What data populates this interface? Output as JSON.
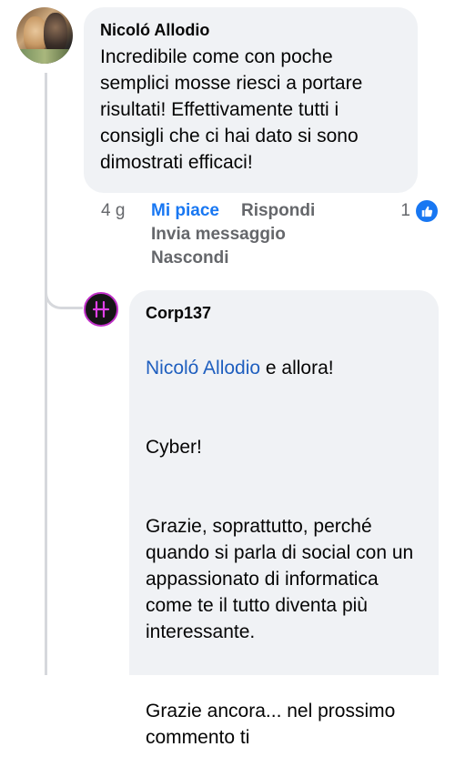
{
  "comment": {
    "author": "Nicoló Allodio",
    "text": "Incredibile come con poche semplici mosse riesci a portare risultati! Effettivamente tutti i consigli che ci hai dato si sono dimostrati efficaci!",
    "time": "4 g",
    "actions": {
      "like": "Mi piace",
      "reply": "Rispondi",
      "send_message": "Invia messaggio",
      "hide": "Nascondi"
    },
    "reaction_count": "1",
    "reaction_icon": "thumbs-up-icon"
  },
  "reply": {
    "author": "Corp137",
    "mention": "Nicoló Allodio",
    "text_after_mention": " e allora!",
    "paragraphs": [
      "Cyber!",
      "Grazie,  soprattutto, perché quando si parla di social con un appassionato di informatica come te  il tutto diventa più interessante.",
      "Grazie ancora... nel prossimo commento ti"
    ]
  },
  "colors": {
    "accent": "#1877f2",
    "bubble": "#f0f2f5",
    "mention": "#1f5fbf",
    "secondary_text": "#65676b",
    "avatar_ring": "#c030c8"
  }
}
